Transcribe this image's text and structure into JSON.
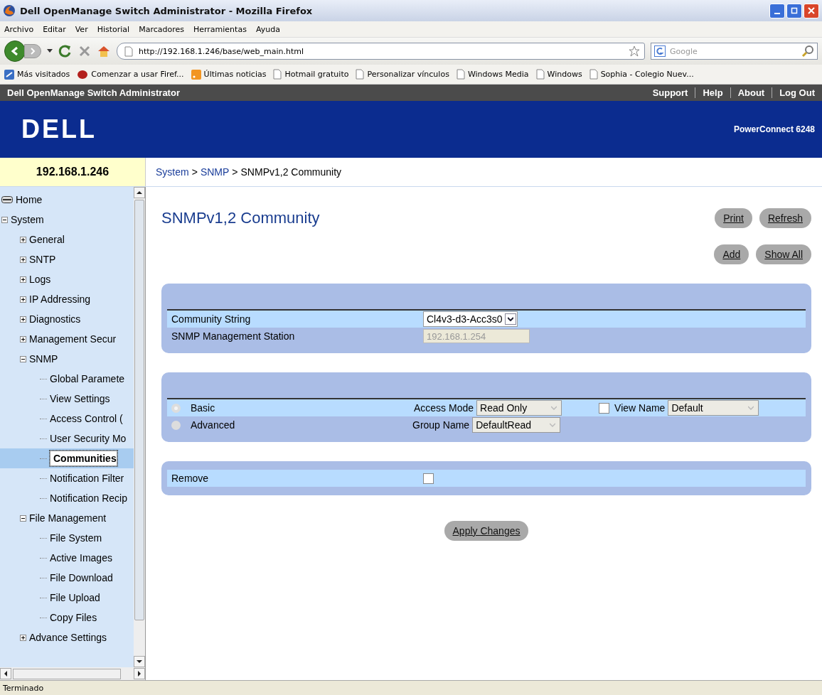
{
  "window": {
    "title": "Dell OpenManage Switch Administrator - Mozilla Firefox"
  },
  "menu": [
    "Archivo",
    "Editar",
    "Ver",
    "Historial",
    "Marcadores",
    "Herramientas",
    "Ayuda"
  ],
  "address": {
    "value": "http://192.168.1.246/base/web_main.html"
  },
  "search": {
    "placeholder": "Google"
  },
  "bookmarks": [
    {
      "label": "Más visitados",
      "kind": "star"
    },
    {
      "label": "Comenzar a usar Firef...",
      "kind": "fox"
    },
    {
      "label": "Últimas noticias",
      "kind": "rss"
    },
    {
      "label": "Hotmail gratuito",
      "kind": "page"
    },
    {
      "label": "Personalizar vínculos",
      "kind": "page"
    },
    {
      "label": "Windows Media",
      "kind": "page"
    },
    {
      "label": "Windows",
      "kind": "page"
    },
    {
      "label": "Sophia - Colegio Nuev...",
      "kind": "page"
    }
  ],
  "app_header": {
    "title": "Dell OpenManage Switch Administrator",
    "links": [
      "Support",
      "Help",
      "About",
      "Log Out"
    ]
  },
  "banner": {
    "logo": "DELL",
    "model": "PowerConnect 6248"
  },
  "device_ip": "192.168.1.246",
  "breadcrumb": {
    "separator": ">",
    "items": [
      {
        "label": "System",
        "link": true
      },
      {
        "label": "SNMP",
        "link": true
      },
      {
        "label": "SNMPv1,2 Community",
        "link": false
      }
    ]
  },
  "sidebar": {
    "items": [
      {
        "label": "Home",
        "kind": "home"
      },
      {
        "label": "System",
        "expanded": true,
        "children": [
          {
            "label": "General",
            "expanded": false
          },
          {
            "label": "SNTP",
            "expanded": false
          },
          {
            "label": "Logs",
            "expanded": false
          },
          {
            "label": "IP Addressing",
            "expanded": false
          },
          {
            "label": "Diagnostics",
            "expanded": false
          },
          {
            "label": "Management Secur",
            "expanded": false
          },
          {
            "label": "SNMP",
            "expanded": true,
            "children": [
              {
                "label": "Global Paramete",
                "selected": false
              },
              {
                "label": "View Settings",
                "selected": false
              },
              {
                "label": "Access Control (",
                "selected": false
              },
              {
                "label": "User Security Mo",
                "selected": false
              },
              {
                "label": "Communities",
                "selected": true
              },
              {
                "label": "Notification Filter",
                "selected": false
              },
              {
                "label": "Notification Recip",
                "selected": false
              }
            ]
          },
          {
            "label": "File Management",
            "expanded": true,
            "children": [
              {
                "label": "File System",
                "selected": false
              },
              {
                "label": "Active Images",
                "selected": false
              },
              {
                "label": "File Download",
                "selected": false
              },
              {
                "label": "File Upload",
                "selected": false
              },
              {
                "label": "Copy Files",
                "selected": false
              }
            ]
          },
          {
            "label": "Advance Settings",
            "expanded": false
          }
        ]
      }
    ]
  },
  "page": {
    "title": "SNMPv1,2 Community",
    "buttons_top": [
      "Print",
      "Refresh"
    ],
    "buttons_second": [
      "Add",
      "Show All"
    ],
    "community_string": {
      "label": "Community String",
      "value": "Cl4v3-d3-Acc3s0"
    },
    "station": {
      "label": "SNMP Management Station",
      "value": "192.168.1.254"
    },
    "basic": {
      "label": "Basic",
      "selected": true
    },
    "advanced": {
      "label": "Advanced",
      "selected": false
    },
    "access_mode": {
      "label": "Access Mode",
      "value": "Read Only"
    },
    "view_name": {
      "label": "View Name",
      "checked": false,
      "value": "Default"
    },
    "group_name": {
      "label": "Group Name",
      "value": "DefaultRead"
    },
    "remove": {
      "label": "Remove",
      "checked": false
    },
    "apply": "Apply Changes"
  },
  "status_bar": "Terminado"
}
